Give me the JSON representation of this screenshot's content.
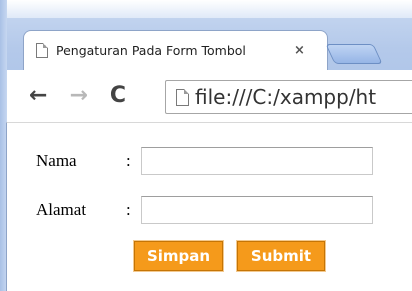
{
  "browser": {
    "tab_title": "Pengaturan Pada Form Tombol",
    "tab_close": "×",
    "nav": {
      "back_icon": "←",
      "forward_icon": "→",
      "reload_icon": "C"
    },
    "address": "file:///C:/xampp/ht"
  },
  "form": {
    "fields": [
      {
        "label": "Nama",
        "colon": ":",
        "value": ""
      },
      {
        "label": "Alamat",
        "colon": ":",
        "value": ""
      }
    ],
    "buttons": {
      "simpan": "Simpan",
      "submit": "Submit"
    }
  },
  "colors": {
    "button_bg": "#f59a1b",
    "chrome_blue": "#a9c1e6"
  }
}
